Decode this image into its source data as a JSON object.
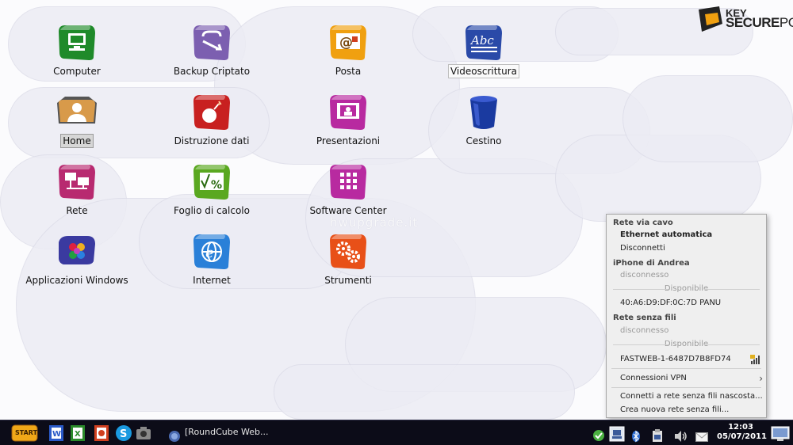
{
  "watermark": "hwupgrade.it",
  "logo": {
    "line1": "KEY",
    "line2_bold": "SECURE",
    "line2_rest": "PC"
  },
  "desktop_icons": [
    {
      "name": "computer",
      "label": "Computer",
      "icon": "computer-icon",
      "color": "#2a8a2a"
    },
    {
      "name": "backup-criptato",
      "label": "Backup Criptato",
      "icon": "backup-icon",
      "color": "#7a5aa8"
    },
    {
      "name": "posta",
      "label": "Posta",
      "icon": "mail-icon",
      "color": "#e8a010"
    },
    {
      "name": "videoscrittura",
      "label": "Videoscrittura",
      "icon": "word-processor-icon",
      "color": "#2a4aa0"
    },
    {
      "name": "home",
      "label": "Home",
      "icon": "home-folder-icon",
      "color": "#c88a3a"
    },
    {
      "name": "distruzione-dati",
      "label": "Distruzione dati",
      "icon": "shredder-icon",
      "color": "#c02020"
    },
    {
      "name": "presentazioni",
      "label": "Presentazioni",
      "icon": "presentation-icon",
      "color": "#b82a9a"
    },
    {
      "name": "cestino",
      "label": "Cestino",
      "icon": "trash-icon",
      "color": "#1a3aa0"
    },
    {
      "name": "rete",
      "label": "Rete",
      "icon": "network-icon",
      "color": "#b82a6a"
    },
    {
      "name": "foglio-di-calcolo",
      "label": "Foglio di calcolo",
      "icon": "spreadsheet-icon",
      "color": "#5aa020"
    },
    {
      "name": "software-center",
      "label": "Software Center",
      "icon": "software-center-icon",
      "color": "#b82a9a"
    },
    {
      "name": "applicazioni-windows",
      "label": "Applicazioni Windows",
      "icon": "windows-apps-icon",
      "color": "#3a3a9a"
    },
    {
      "name": "internet",
      "label": "Internet",
      "icon": "internet-icon",
      "color": "#2a7ad0"
    },
    {
      "name": "strumenti",
      "label": "Strumenti",
      "icon": "tools-icon",
      "color": "#e05010"
    }
  ],
  "network_menu": {
    "wired_header": "Rete via cavo",
    "wired_auto": "Ethernet automatica",
    "wired_disconnect": "Disconnetti",
    "iphone_header": "iPhone di Andrea",
    "iphone_status": "disconnesso",
    "available_1": "Disponibile",
    "bt_device": "40:A6:D9:DF:0C:7D PANU",
    "wireless_header": "Rete senza fili",
    "wireless_status": "disconnesso",
    "available_2": "Disponibile",
    "wifi_network": "FASTWEB-1-6487D7B8FD74",
    "vpn": "Connessioni VPN",
    "connect_hidden": "Connetti a rete senza fili nascosta...",
    "create_new": "Crea nuova rete senza fili..."
  },
  "taskbar": {
    "start_label": "START",
    "window_title": "[RoundCube Web...",
    "time": "12:03",
    "date": "05/07/2011"
  }
}
